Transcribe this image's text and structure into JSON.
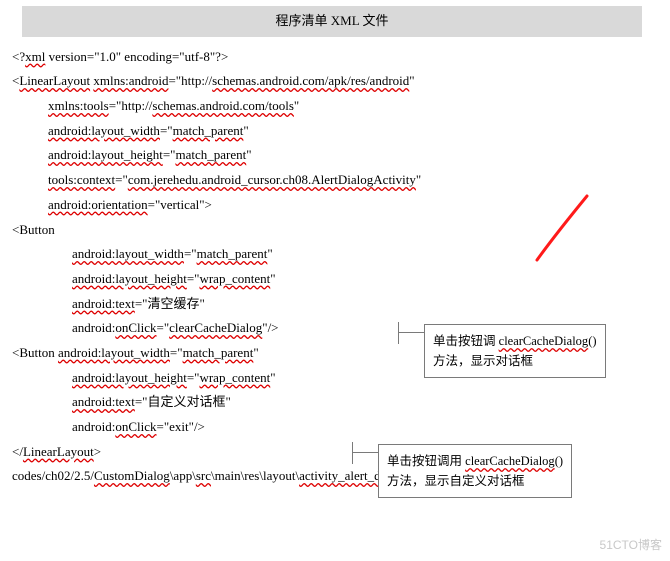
{
  "title": "程序清单  XML 文件",
  "code": {
    "l01a": "<?",
    "l01b": "xml",
    "l01c": " version=\"1.0\" encoding=\"utf-8\"?>",
    "l02a": "<",
    "l02b": "LinearLayout",
    "l02c": " ",
    "l02d": "xmlns:android",
    "l02e": "=\"http://",
    "l02f": "schemas.android.com/apk/res/android",
    "l02g": "\"",
    "l03a": "xmlns:tools",
    "l03b": "=\"http://",
    "l03c": "schemas.android.com/tools",
    "l03d": "\"",
    "l04a": "android:layout_width",
    "l04b": "=\"",
    "l04c": "match_parent",
    "l04d": "\"",
    "l05a": "android:layout_height",
    "l05b": "=\"",
    "l05c": "match_parent",
    "l05d": "\"",
    "l06a": "tools:context",
    "l06b": "=\"",
    "l06c": "com.jerehedu.android_cursor.ch08.AlertDialogActivity",
    "l06d": "\"",
    "l07a": "android:orientation",
    "l07b": "=\"vertical\">",
    "l08": "<Button",
    "l09a": "android:layout_width",
    "l09b": "=\"",
    "l09c": "match_parent",
    "l09d": "\"",
    "l10a": "android:layout_height",
    "l10b": "=\"",
    "l10c": "wrap_content",
    "l10d": "\"",
    "l11a": "android:text",
    "l11b": "=\"清空缓存\"",
    "l12a": "android:",
    "l12b": "onClick",
    "l12c": "=\"",
    "l12d": "clearCacheDialog",
    "l12e": "\"/>",
    "l13a": "<Button  ",
    "l13b": "android:layout_width",
    "l13c": "=\"",
    "l13d": "match_parent",
    "l13e": "\"",
    "l14a": "android:layout_height",
    "l14b": "=\"",
    "l14c": "wrap_content",
    "l14d": "\"",
    "l15a": "android:text",
    "l15b": "=\"自定义对话框\"",
    "l16a": "android:",
    "l16b": "onClick",
    "l16c": "=\"exit\"/>",
    "l17a": "</",
    "l17b": "LinearLayout",
    "l17c": ">",
    "l18a": "codes/ch02/2.5/",
    "l18b": "CustomDialog",
    "l18c": "\\app\\",
    "l18d": "src",
    "l18e": "\\main\\res\\layout\\",
    "l18f": "activity_alert_dialog",
    "l18g": ".."
  },
  "callout1": {
    "a": "单击按钮调 ",
    "b": "clearCacheDialog",
    "c": "()",
    "d": "方法，显示对话框"
  },
  "callout2": {
    "a": "单击按钮调用 ",
    "b": "clearCacheDialog",
    "c": "()",
    "d": "方法，显示自定义对话框"
  },
  "watermark": "51CTO博客"
}
